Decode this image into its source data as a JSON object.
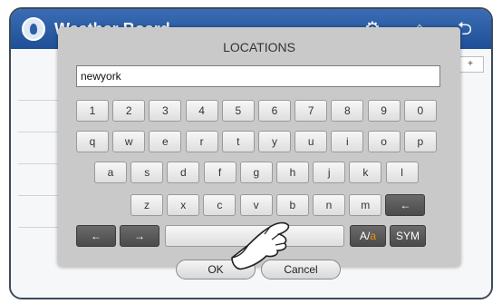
{
  "app": {
    "title": "Weather Board",
    "icons": [
      "app-icon",
      "settings-icon",
      "home-icon",
      "back-icon"
    ],
    "plus_label": "+"
  },
  "dialog": {
    "title": "LOCATIONS",
    "input_value": "newyork",
    "row1": [
      "1",
      "2",
      "3",
      "4",
      "5",
      "6",
      "7",
      "8",
      "9",
      "0"
    ],
    "row2": [
      "q",
      "w",
      "e",
      "r",
      "t",
      "y",
      "u",
      "i",
      "o",
      "p"
    ],
    "row3": [
      "a",
      "s",
      "d",
      "f",
      "g",
      "h",
      "j",
      "k",
      "l"
    ],
    "row4": [
      "z",
      "x",
      "c",
      "v",
      "b",
      "n",
      "m"
    ],
    "backspace_symbol": "←",
    "left_arrow": "←",
    "right_arrow": "→",
    "case_left": "A/",
    "case_right": "a",
    "sym_label": "SYM",
    "ok_label": "OK",
    "cancel_label": "Cancel"
  },
  "colors": {
    "accent": "#f39200",
    "titlebar": "#2a5ea8",
    "dialog_bg": "#c9c9c9"
  }
}
